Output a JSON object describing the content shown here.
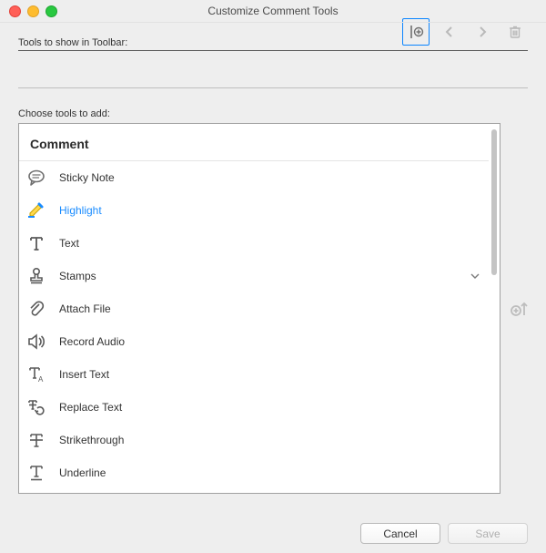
{
  "window": {
    "title": "Customize Comment Tools"
  },
  "sections": {
    "toolbar_label": "Tools to show in Toolbar:",
    "choose_label": "Choose tools to add:"
  },
  "top_toolbar": {
    "divider_icon": "divider-plus",
    "prev_icon": "chevron-left",
    "next_icon": "chevron-right",
    "delete_icon": "trash"
  },
  "tools": {
    "group_header": "Comment",
    "items": [
      {
        "label": "Sticky Note",
        "icon": "speech-bubble",
        "selected": false,
        "expandable": false
      },
      {
        "label": "Highlight",
        "icon": "highlighter",
        "selected": true,
        "expandable": false
      },
      {
        "label": "Text",
        "icon": "text-t",
        "selected": false,
        "expandable": false
      },
      {
        "label": "Stamps",
        "icon": "stamp",
        "selected": false,
        "expandable": true
      },
      {
        "label": "Attach File",
        "icon": "paperclip",
        "selected": false,
        "expandable": false
      },
      {
        "label": "Record Audio",
        "icon": "speaker",
        "selected": false,
        "expandable": false
      },
      {
        "label": "Insert Text",
        "icon": "insert-text",
        "selected": false,
        "expandable": false
      },
      {
        "label": "Replace Text",
        "icon": "replace-text",
        "selected": false,
        "expandable": false
      },
      {
        "label": "Strikethrough",
        "icon": "strikethrough",
        "selected": false,
        "expandable": false
      },
      {
        "label": "Underline",
        "icon": "underline",
        "selected": false,
        "expandable": false
      }
    ]
  },
  "side": {
    "add_icon": "plus-up"
  },
  "footer": {
    "cancel": "Cancel",
    "save": "Save",
    "save_enabled": false
  }
}
